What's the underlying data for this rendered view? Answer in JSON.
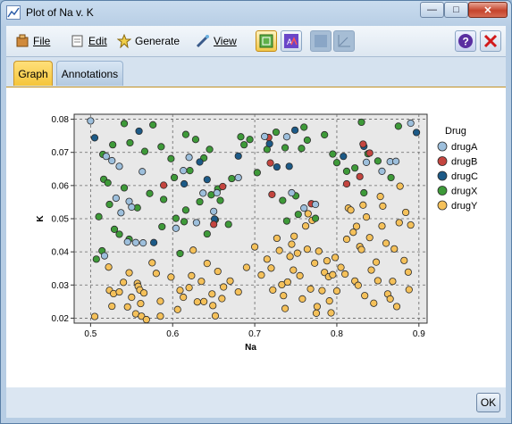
{
  "window": {
    "title": "Plot of Na v. K",
    "minimize": "—",
    "maximize": "□",
    "close": "✕"
  },
  "menu": {
    "file": "File",
    "edit": "Edit",
    "generate": "Generate",
    "view": "View"
  },
  "toolbar_icons": [
    "chart-select-icon",
    "chart-annotate-icon",
    "chart-type-icon",
    "axis-icon",
    "help-icon",
    "close-red-icon"
  ],
  "tabs": [
    {
      "label": "Graph",
      "selected": true
    },
    {
      "label": "Annotations",
      "selected": false
    }
  ],
  "ok_label": "OK",
  "colors": {
    "drugA": "#9dbfdc",
    "drugB": "#c4453f",
    "drugC": "#1c5a87",
    "drugX": "#3e9a39",
    "drugY": "#f5c15a",
    "plot_bg": "#e8e8e8"
  },
  "chart_data": {
    "type": "scatter",
    "xlabel": "Na",
    "ylabel": "K",
    "xlim": [
      0.48,
      0.91
    ],
    "ylim": [
      0.0185,
      0.0815
    ],
    "xticks": [
      "0.5",
      "0.6",
      "0.7",
      "0.8",
      "0.9"
    ],
    "yticks": [
      "0.02",
      "0.03",
      "0.04",
      "0.05",
      "0.06",
      "0.07",
      "0.08"
    ],
    "grid": true,
    "legend": {
      "title": "Drug",
      "position": "right"
    },
    "series": [
      {
        "name": "drugA",
        "points": [
          [
            0.5,
            0.0795
          ],
          [
            0.519,
            0.0688
          ],
          [
            0.526,
            0.0675
          ],
          [
            0.535,
            0.0658
          ],
          [
            0.531,
            0.0562
          ],
          [
            0.547,
            0.0552
          ],
          [
            0.55,
            0.0535
          ],
          [
            0.555,
            0.0428
          ],
          [
            0.564,
            0.0427
          ],
          [
            0.545,
            0.043
          ],
          [
            0.517,
            0.0388
          ],
          [
            0.537,
            0.0518
          ],
          [
            0.563,
            0.0642
          ],
          [
            0.613,
            0.0645
          ],
          [
            0.62,
            0.0685
          ],
          [
            0.637,
            0.0577
          ],
          [
            0.654,
            0.0578
          ],
          [
            0.68,
            0.0624
          ],
          [
            0.712,
            0.0748
          ],
          [
            0.739,
            0.0747
          ],
          [
            0.745,
            0.0578
          ],
          [
            0.76,
            0.0532
          ],
          [
            0.774,
            0.0543
          ],
          [
            0.836,
            0.067
          ],
          [
            0.855,
            0.0643
          ],
          [
            0.865,
            0.0672
          ],
          [
            0.872,
            0.0673
          ],
          [
            0.89,
            0.0788
          ],
          [
            0.65,
            0.0522
          ],
          [
            0.604,
            0.0471
          ],
          [
            0.629,
            0.0488
          ]
        ]
      },
      {
        "name": "drugB",
        "points": [
          [
            0.589,
            0.0601
          ],
          [
            0.661,
            0.0597
          ],
          [
            0.717,
            0.0745
          ],
          [
            0.719,
            0.0668
          ],
          [
            0.721,
            0.0573
          ],
          [
            0.769,
            0.0545
          ],
          [
            0.812,
            0.0605
          ],
          [
            0.832,
            0.0725
          ],
          [
            0.84,
            0.0698
          ],
          [
            0.828,
            0.0627
          ],
          [
            0.65,
            0.0483
          ]
        ]
      },
      {
        "name": "drugC",
        "points": [
          [
            0.505,
            0.0744
          ],
          [
            0.559,
            0.0764
          ],
          [
            0.577,
            0.0428
          ],
          [
            0.614,
            0.0605
          ],
          [
            0.633,
            0.0671
          ],
          [
            0.642,
            0.0618
          ],
          [
            0.651,
            0.0499
          ],
          [
            0.68,
            0.0689
          ],
          [
            0.718,
            0.0726
          ],
          [
            0.727,
            0.0656
          ],
          [
            0.742,
            0.0658
          ],
          [
            0.749,
            0.0767
          ],
          [
            0.808,
            0.0688
          ],
          [
            0.833,
            0.0718
          ],
          [
            0.897,
            0.076
          ]
        ]
      },
      {
        "name": "drugX",
        "points": [
          [
            0.507,
            0.0378
          ],
          [
            0.51,
            0.0506
          ],
          [
            0.514,
            0.0403
          ],
          [
            0.515,
            0.0694
          ],
          [
            0.516,
            0.0619
          ],
          [
            0.521,
            0.0608
          ],
          [
            0.523,
            0.0543
          ],
          [
            0.527,
            0.0723
          ],
          [
            0.529,
            0.0468
          ],
          [
            0.535,
            0.0453
          ],
          [
            0.541,
            0.0593
          ],
          [
            0.541,
            0.0787
          ],
          [
            0.547,
            0.0438
          ],
          [
            0.548,
            0.0729
          ],
          [
            0.557,
            0.0533
          ],
          [
            0.566,
            0.0703
          ],
          [
            0.572,
            0.0576
          ],
          [
            0.576,
            0.0783
          ],
          [
            0.586,
            0.0717
          ],
          [
            0.587,
            0.0476
          ],
          [
            0.589,
            0.0558
          ],
          [
            0.598,
            0.0681
          ],
          [
            0.602,
            0.0624
          ],
          [
            0.604,
            0.0501
          ],
          [
            0.609,
            0.0395
          ],
          [
            0.614,
            0.0491
          ],
          [
            0.616,
            0.0526
          ],
          [
            0.616,
            0.0754
          ],
          [
            0.621,
            0.0645
          ],
          [
            0.628,
            0.0739
          ],
          [
            0.633,
            0.0551
          ],
          [
            0.638,
            0.0683
          ],
          [
            0.642,
            0.0454
          ],
          [
            0.645,
            0.0709
          ],
          [
            0.647,
            0.0572
          ],
          [
            0.652,
            0.0497
          ],
          [
            0.655,
            0.059
          ],
          [
            0.658,
            0.0555
          ],
          [
            0.668,
            0.0483
          ],
          [
            0.672,
            0.0621
          ],
          [
            0.683,
            0.0747
          ],
          [
            0.687,
            0.0723
          ],
          [
            0.694,
            0.0739
          ],
          [
            0.703,
            0.0639
          ],
          [
            0.715,
            0.0709
          ],
          [
            0.726,
            0.0761
          ],
          [
            0.734,
            0.0555
          ],
          [
            0.737,
            0.0714
          ],
          [
            0.739,
            0.0493
          ],
          [
            0.75,
            0.0569
          ],
          [
            0.753,
            0.0513
          ],
          [
            0.757,
            0.0712
          ],
          [
            0.76,
            0.0776
          ],
          [
            0.764,
            0.0737
          ],
          [
            0.774,
            0.0501
          ],
          [
            0.785,
            0.0753
          ],
          [
            0.795,
            0.0695
          ],
          [
            0.8,
            0.0669
          ],
          [
            0.812,
            0.0643
          ],
          [
            0.822,
            0.0653
          ],
          [
            0.83,
            0.0791
          ],
          [
            0.833,
            0.0578
          ],
          [
            0.838,
            0.0696
          ],
          [
            0.85,
            0.0674
          ],
          [
            0.866,
            0.0624
          ],
          [
            0.875,
            0.0779
          ]
        ]
      },
      {
        "name": "drugY",
        "points": [
          [
            0.505,
            0.0205
          ],
          [
            0.522,
            0.0354
          ],
          [
            0.523,
            0.0284
          ],
          [
            0.526,
            0.0236
          ],
          [
            0.528,
            0.0274
          ],
          [
            0.535,
            0.0279
          ],
          [
            0.54,
            0.0308
          ],
          [
            0.545,
            0.0234
          ],
          [
            0.547,
            0.0337
          ],
          [
            0.55,
            0.0263
          ],
          [
            0.555,
            0.0213
          ],
          [
            0.557,
            0.0305
          ],
          [
            0.558,
            0.0296
          ],
          [
            0.56,
            0.0285
          ],
          [
            0.561,
            0.0244
          ],
          [
            0.562,
            0.0206
          ],
          [
            0.565,
            0.0276
          ],
          [
            0.568,
            0.0183
          ],
          [
            0.575,
            0.0367
          ],
          [
            0.58,
            0.0335
          ],
          [
            0.585,
            0.0206
          ],
          [
            0.585,
            0.0251
          ],
          [
            0.598,
            0.0324
          ],
          [
            0.606,
            0.0226
          ],
          [
            0.609,
            0.0284
          ],
          [
            0.613,
            0.0263
          ],
          [
            0.62,
            0.0292
          ],
          [
            0.623,
            0.0328
          ],
          [
            0.625,
            0.0405
          ],
          [
            0.63,
            0.0249
          ],
          [
            0.635,
            0.0311
          ],
          [
            0.638,
            0.025
          ],
          [
            0.642,
            0.0365
          ],
          [
            0.648,
            0.0273
          ],
          [
            0.649,
            0.0238
          ],
          [
            0.652,
            0.0207
          ],
          [
            0.655,
            0.0341
          ],
          [
            0.66,
            0.0259
          ],
          [
            0.662,
            0.0294
          ],
          [
            0.67,
            0.0312
          ],
          [
            0.68,
            0.0279
          ],
          [
            0.69,
            0.0353
          ],
          [
            0.7,
            0.0415
          ],
          [
            0.708,
            0.033
          ],
          [
            0.715,
            0.0378
          ],
          [
            0.72,
            0.0351
          ],
          [
            0.722,
            0.0285
          ],
          [
            0.727,
            0.0441
          ],
          [
            0.73,
            0.0404
          ],
          [
            0.733,
            0.0301
          ],
          [
            0.735,
            0.0268
          ],
          [
            0.737,
            0.0229
          ],
          [
            0.74,
            0.0309
          ],
          [
            0.743,
            0.0386
          ],
          [
            0.745,
            0.0423
          ],
          [
            0.747,
            0.0345
          ],
          [
            0.748,
            0.0447
          ],
          [
            0.752,
            0.0396
          ],
          [
            0.755,
            0.0328
          ],
          [
            0.758,
            0.0258
          ],
          [
            0.762,
            0.0478
          ],
          [
            0.764,
            0.0408
          ],
          [
            0.765,
            0.0515
          ],
          [
            0.768,
            0.0288
          ],
          [
            0.77,
            0.0495
          ],
          [
            0.773,
            0.0366
          ],
          [
            0.775,
            0.0215
          ],
          [
            0.776,
            0.0235
          ],
          [
            0.778,
            0.0402
          ],
          [
            0.782,
            0.0283
          ],
          [
            0.785,
            0.0338
          ],
          [
            0.788,
            0.0373
          ],
          [
            0.79,
            0.0325
          ],
          [
            0.791,
            0.0252
          ],
          [
            0.793,
            0.0216
          ],
          [
            0.795,
            0.0331
          ],
          [
            0.798,
            0.0383
          ],
          [
            0.8,
            0.0282
          ],
          [
            0.805,
            0.0353
          ],
          [
            0.81,
            0.0333
          ],
          [
            0.812,
            0.0438
          ],
          [
            0.814,
            0.0532
          ],
          [
            0.817,
            0.0526
          ],
          [
            0.82,
            0.0459
          ],
          [
            0.822,
            0.0312
          ],
          [
            0.824,
            0.0477
          ],
          [
            0.826,
            0.0299
          ],
          [
            0.828,
            0.0416
          ],
          [
            0.83,
            0.0407
          ],
          [
            0.832,
            0.0541
          ],
          [
            0.834,
            0.0268
          ],
          [
            0.836,
            0.0505
          ],
          [
            0.84,
            0.0443
          ],
          [
            0.842,
            0.0345
          ],
          [
            0.845,
            0.0245
          ],
          [
            0.848,
            0.0369
          ],
          [
            0.85,
            0.0313
          ],
          [
            0.853,
            0.0567
          ],
          [
            0.855,
            0.0478
          ],
          [
            0.856,
            0.0538
          ],
          [
            0.86,
            0.0426
          ],
          [
            0.862,
            0.0273
          ],
          [
            0.865,
            0.0258
          ],
          [
            0.868,
            0.0311
          ],
          [
            0.87,
            0.0409
          ],
          [
            0.873,
            0.0235
          ],
          [
            0.876,
            0.0488
          ],
          [
            0.877,
            0.0598
          ],
          [
            0.882,
            0.0374
          ],
          [
            0.884,
            0.0519
          ],
          [
            0.887,
            0.0339
          ],
          [
            0.888,
            0.0286
          ],
          [
            0.89,
            0.0481
          ]
        ]
      }
    ]
  }
}
